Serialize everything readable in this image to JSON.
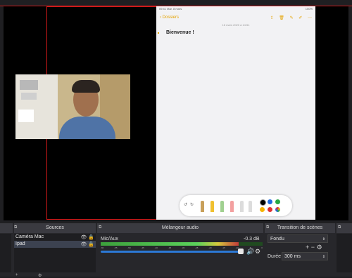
{
  "ipad": {
    "status_left": "09:41 Mar. 8 mars",
    "status_right": "100%",
    "back": "Dossiers",
    "date": "16 mars 2020 à 14:51",
    "note_title": "Bienvenue !",
    "tools": [
      "share-icon",
      "trash-icon",
      "pen-icon",
      "compose-icon",
      "more-icon"
    ],
    "colors": [
      "#000000",
      "#1e6be0",
      "#28a745",
      "#f5b400",
      "#e03030",
      "#8e44ad"
    ]
  },
  "sources": {
    "header": "Sources",
    "items": [
      {
        "label": "Caméra Mac",
        "selected": false
      },
      {
        "label": "Ipad",
        "selected": true
      }
    ]
  },
  "mixer": {
    "header": "Mélangeur audio",
    "channel": "Mic/Aux",
    "level_db": "-0.3 dB",
    "meter_fill": 0.85,
    "volume_fraction": 0.87,
    "ticks": [
      "-60",
      "-55",
      "-50",
      "-45",
      "-40",
      "-35",
      "-30",
      "-25",
      "-20",
      "-15",
      "-10",
      "-5",
      "0"
    ]
  },
  "transitions": {
    "header": "Transition de scènes",
    "selected": "Fondu",
    "duree_label": "Durée",
    "duree_value": "300 ms"
  },
  "colors": {
    "accent": "#2c79d6",
    "preview_border": "#d11a1a"
  }
}
